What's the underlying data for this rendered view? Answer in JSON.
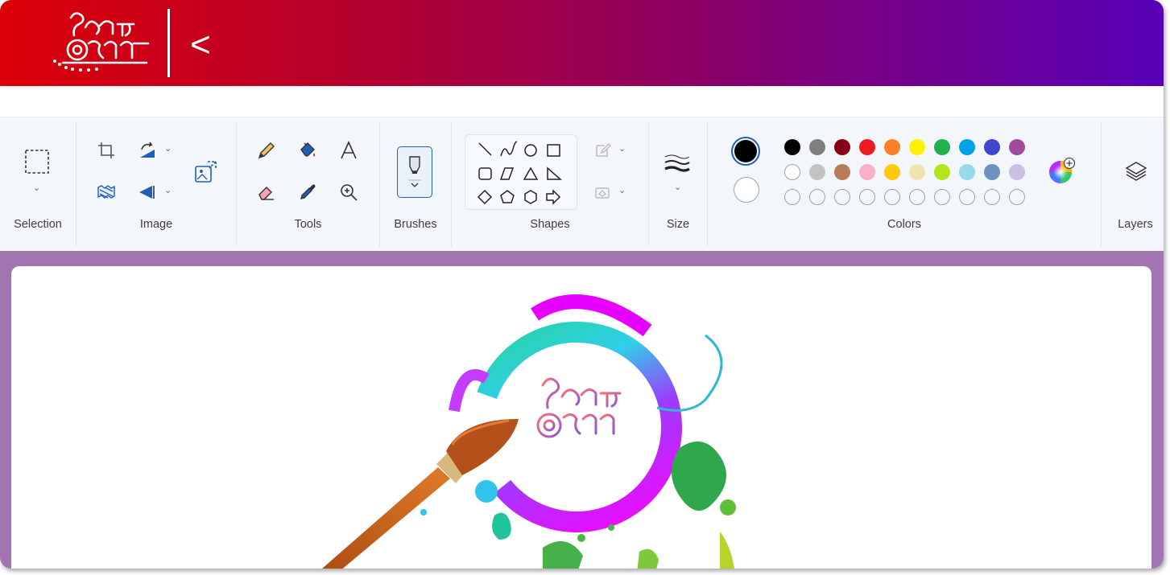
{
  "header": {
    "logo_text": "উৎসবে আল্পনায়",
    "back_label": "<",
    "gradient": [
      "#dc0008",
      "#9a0050",
      "#5800b8"
    ]
  },
  "toolbar": {
    "groups": {
      "selection": "Selection",
      "image": "Image",
      "tools": "Tools",
      "brushes": "Brushes",
      "shapes": "Shapes",
      "size": "Size",
      "colors": "Colors",
      "layers": "Layers"
    },
    "icons": {
      "selection": "rectangle-select-icon",
      "image": [
        "crop-icon",
        "rotate-icon",
        "resize-icon",
        "flip-icon",
        "background-remove-icon"
      ],
      "tools": [
        "pencil-icon",
        "fill-bucket-icon",
        "text-icon",
        "eraser-icon",
        "color-picker-icon",
        "magnifier-icon"
      ],
      "brushes": "brush-icon",
      "shapes": [
        "line",
        "curve",
        "oval",
        "rectangle",
        "rounded-rectangle",
        "polygon",
        "triangle",
        "right-triangle",
        "diamond",
        "pentagon",
        "hexagon",
        "right-arrow"
      ],
      "size": "stroke-size-icon",
      "layers": "layers-icon"
    }
  },
  "colors": {
    "primary": "#000000",
    "secondary": "#ffffff",
    "row1": [
      "#000000",
      "#7f7f7f",
      "#880015",
      "#ed1c24",
      "#ff7f27",
      "#fff200",
      "#22b14c",
      "#00a2e8",
      "#3f48cc",
      "#a349a4"
    ],
    "row2": [
      "#ffffff",
      "#c3c3c3",
      "#b97a57",
      "#ffaec9",
      "#ffc90e",
      "#efe4b0",
      "#b5e61d",
      "#99d9ea",
      "#7092be",
      "#c8bfe7"
    ],
    "row3_empty_count": 10
  },
  "canvas": {
    "background": "#a374b2",
    "artwork_text": "উৎসবে আল্পনায়"
  }
}
